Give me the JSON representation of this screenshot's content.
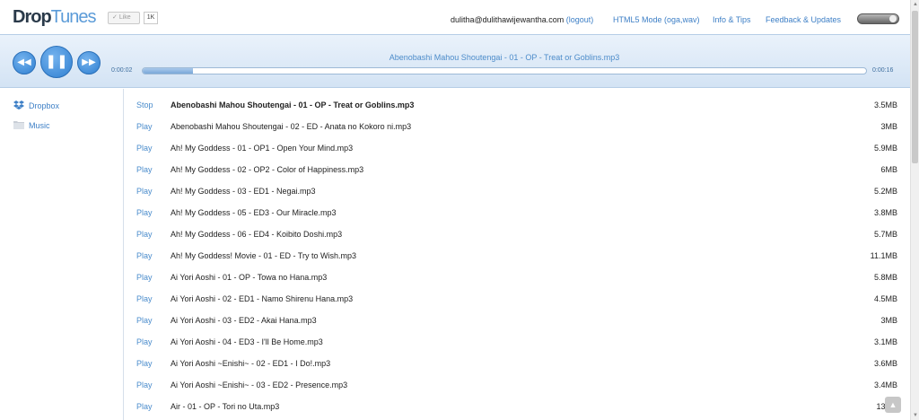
{
  "header": {
    "logo_part1": "Drop",
    "logo_part2": "Tunes",
    "like_label": "Like",
    "like_count": "1K",
    "user_email": "dulitha@dulithawijewantha.com",
    "logout_label": "(logout)",
    "links": [
      "HTML5 Mode (oga,wav)",
      "Info & Tips",
      "Feedback & Updates"
    ]
  },
  "player": {
    "track_title": "Abenobashi Mahou Shoutengai - 01 - OP - Treat or Goblins.mp3",
    "time_current": "0:00:02",
    "time_total": "0:00:16",
    "progress_fraction": 0.07
  },
  "sidebar": {
    "items": [
      {
        "label": "Dropbox",
        "icon": "dropbox-icon"
      },
      {
        "label": "Music",
        "icon": "folder-icon"
      }
    ]
  },
  "files": [
    {
      "action": "Stop",
      "name": "Abenobashi Mahou Shoutengai - 01 - OP - Treat or Goblins.mp3",
      "size": "3.5MB",
      "active": true
    },
    {
      "action": "Play",
      "name": "Abenobashi Mahou Shoutengai - 02 - ED - Anata no Kokoro ni.mp3",
      "size": "3MB"
    },
    {
      "action": "Play",
      "name": "Ah! My Goddess - 01 - OP1 - Open Your Mind.mp3",
      "size": "5.9MB"
    },
    {
      "action": "Play",
      "name": "Ah! My Goddess - 02 - OP2 - Color of Happiness.mp3",
      "size": "6MB"
    },
    {
      "action": "Play",
      "name": "Ah! My Goddess - 03 - ED1 - Negai.mp3",
      "size": "5.2MB"
    },
    {
      "action": "Play",
      "name": "Ah! My Goddess - 05 - ED3 - Our Miracle.mp3",
      "size": "3.8MB"
    },
    {
      "action": "Play",
      "name": "Ah! My Goddess - 06 - ED4 - Koibito Doshi.mp3",
      "size": "5.7MB"
    },
    {
      "action": "Play",
      "name": "Ah! My Goddess! Movie - 01 - ED - Try to Wish.mp3",
      "size": "11.1MB"
    },
    {
      "action": "Play",
      "name": "Ai Yori Aoshi - 01 - OP - Towa no Hana.mp3",
      "size": "5.8MB"
    },
    {
      "action": "Play",
      "name": "Ai Yori Aoshi - 02 - ED1 - Namo Shirenu Hana.mp3",
      "size": "4.5MB"
    },
    {
      "action": "Play",
      "name": "Ai Yori Aoshi - 03 - ED2 - Akai Hana.mp3",
      "size": "3MB"
    },
    {
      "action": "Play",
      "name": "Ai Yori Aoshi - 04 - ED3 - I'll Be Home.mp3",
      "size": "3.1MB"
    },
    {
      "action": "Play",
      "name": "Ai Yori Aoshi ~Enishi~ - 02 - ED1 - I Do!.mp3",
      "size": "3.6MB"
    },
    {
      "action": "Play",
      "name": "Ai Yori Aoshi ~Enishi~ - 03 - ED2 - Presence.mp3",
      "size": "3.4MB"
    },
    {
      "action": "Play",
      "name": "Air - 01 - OP - Tori no Uta.mp3",
      "size": "13MB"
    }
  ]
}
